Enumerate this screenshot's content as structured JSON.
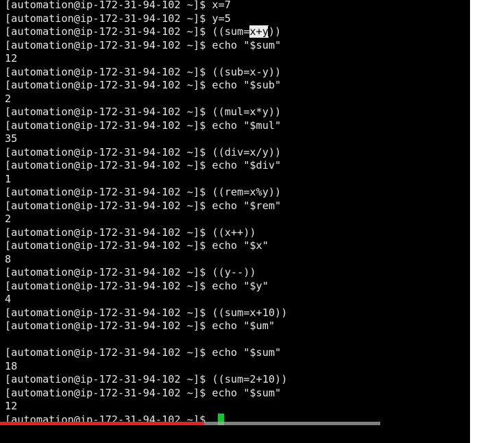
{
  "terminal": {
    "prompt": "[automation@ip-172-31-94-102 ~]$ ",
    "lines": [
      {
        "kind": "cmd",
        "text": "x=7"
      },
      {
        "kind": "cmd",
        "text": "y=5"
      },
      {
        "kind": "cmd-selected",
        "before": "((sum=",
        "selected": "x+y",
        "after": "))"
      },
      {
        "kind": "cmd",
        "text": "echo \"$sum\""
      },
      {
        "kind": "out",
        "text": "12"
      },
      {
        "kind": "cmd",
        "text": "((sub=x-y))"
      },
      {
        "kind": "cmd",
        "text": "echo \"$sub\""
      },
      {
        "kind": "out",
        "text": "2"
      },
      {
        "kind": "cmd",
        "text": "((mul=x*y))"
      },
      {
        "kind": "cmd",
        "text": "echo \"$mul\""
      },
      {
        "kind": "out",
        "text": "35"
      },
      {
        "kind": "cmd",
        "text": "((div=x/y))"
      },
      {
        "kind": "cmd",
        "text": "echo \"$div\""
      },
      {
        "kind": "out",
        "text": "1"
      },
      {
        "kind": "cmd",
        "text": "((rem=x%y))"
      },
      {
        "kind": "cmd",
        "text": "echo \"$rem\""
      },
      {
        "kind": "out",
        "text": "2"
      },
      {
        "kind": "cmd",
        "text": "((x++))"
      },
      {
        "kind": "cmd",
        "text": "echo \"$x\""
      },
      {
        "kind": "out",
        "text": "8"
      },
      {
        "kind": "cmd",
        "text": "((y--))"
      },
      {
        "kind": "cmd",
        "text": "echo \"$y\""
      },
      {
        "kind": "out",
        "text": "4"
      },
      {
        "kind": "cmd",
        "text": "((sum=x+10))"
      },
      {
        "kind": "cmd",
        "text": "echo \"$um\""
      },
      {
        "kind": "out",
        "text": ""
      },
      {
        "kind": "cmd",
        "text": "echo \"$sum\""
      },
      {
        "kind": "out",
        "text": "18"
      },
      {
        "kind": "cmd",
        "text": "((sum=2+10))"
      },
      {
        "kind": "cmd",
        "text": "echo \"$sum\""
      },
      {
        "kind": "out",
        "text": "12"
      },
      {
        "kind": "cursor",
        "text": ""
      }
    ],
    "cursor_color": "#15c431",
    "foreground_color": "#e6e6e6",
    "background_color": "#000000"
  },
  "player": {
    "progress_fraction": 0.425,
    "buffered_fraction": 0.79,
    "progress_color": "#ef1f1f",
    "track_color": "#aaaaaa"
  }
}
